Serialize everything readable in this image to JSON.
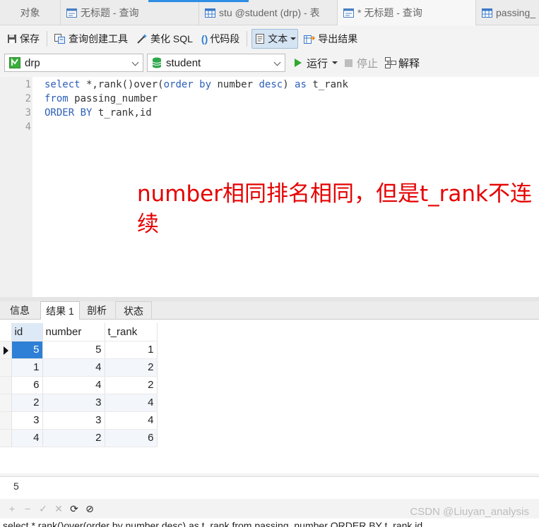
{
  "tabs": [
    {
      "label": "对象",
      "icon": "none"
    },
    {
      "label": "无标题 - 查询",
      "icon": "query-icon"
    },
    {
      "label": "stu @student (drp) - 表",
      "icon": "table-icon"
    },
    {
      "label": "* 无标题 - 查询",
      "icon": "query-icon"
    },
    {
      "label": "passing_",
      "icon": "table-icon"
    }
  ],
  "toolbar": {
    "save": "保存",
    "query_builder": "查询创建工具",
    "beautify": "美化 SQL",
    "snippet": "代码段",
    "text": "文本",
    "export": "导出结果"
  },
  "connection": {
    "connection_name": "drp",
    "database_name": "student",
    "run": "运行",
    "stop": "停止",
    "explain": "解释"
  },
  "editor": {
    "line_numbers": [
      "1",
      "2",
      "3",
      "4"
    ],
    "line1": {
      "kw1": "select",
      "t1": " *,rank()over(",
      "kw2": "order by",
      "t2": " number ",
      "kw3": "desc",
      "t3": ") ",
      "kw4": "as",
      "t4": " t_rank"
    },
    "line2": {
      "kw1": "from",
      "t1": " passing_number"
    },
    "line3": {
      "kw1": "ORDER BY",
      "t1": " t_rank,id"
    },
    "annotation": "number相同排名相同，但是t_rank不连续"
  },
  "result_tabs": [
    "信息",
    "结果 1",
    "剖析",
    "状态"
  ],
  "grid": {
    "columns": [
      "id",
      "number",
      "t_rank"
    ],
    "rows": [
      [
        "5",
        "5",
        "1"
      ],
      [
        "1",
        "4",
        "2"
      ],
      [
        "6",
        "4",
        "2"
      ],
      [
        "2",
        "3",
        "4"
      ],
      [
        "3",
        "3",
        "4"
      ],
      [
        "4",
        "2",
        "6"
      ]
    ]
  },
  "second_pane_value": "5",
  "nav": {
    "add": "+",
    "remove": "−",
    "apply": "✓",
    "discard": "✕",
    "refresh": "⟳",
    "stop": "⊘"
  },
  "watermark": "CSDN @Liuyan_analysis",
  "status_sql": "select *,rank()over(order by number desc) as t_rank from passing_number ORDER BY t_rank,id"
}
